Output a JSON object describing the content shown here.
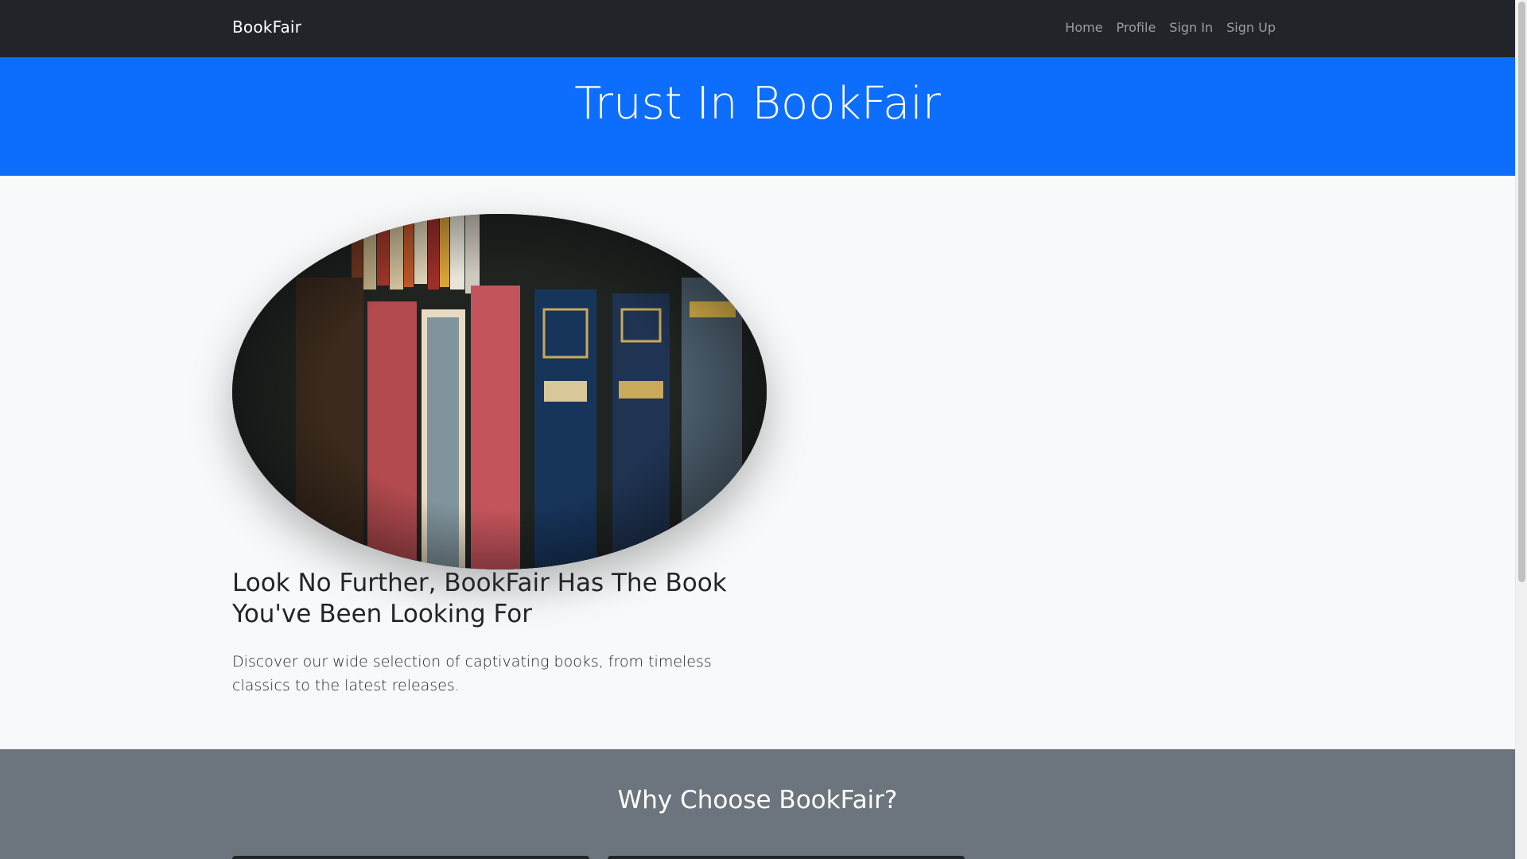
{
  "navbar": {
    "brand": "BookFair",
    "links": [
      "Home",
      "Profile",
      "Sign In",
      "Sign Up"
    ]
  },
  "hero": {
    "title": "Trust In BookFair"
  },
  "feature": {
    "image_icon": "bookshelf-photo",
    "heading": "Look No Further, BookFair Has The Book You've Been Looking For",
    "text": "Discover our wide selection of captivating books, from timeless classics to the latest releases."
  },
  "why": {
    "title": "Why Choose BookFair?"
  },
  "colors": {
    "navbar_bg": "#212529",
    "hero_bg": "#0d6efd",
    "feature_bg": "#f8f9fa",
    "why_bg": "#6c757d"
  }
}
